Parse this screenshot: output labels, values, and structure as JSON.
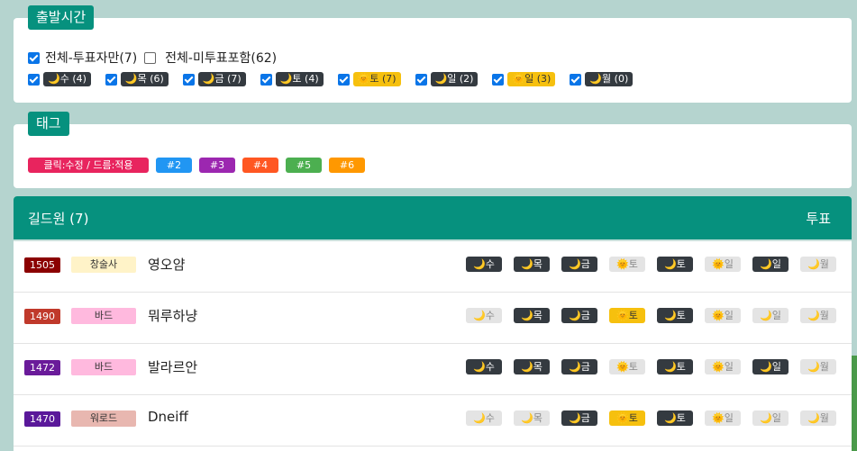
{
  "departure": {
    "title": "출발시간",
    "all_voted": "전체-투표자만(7)",
    "all_including": "전체-미투표포함(62)",
    "slots": [
      {
        "label": "🌙수 (4)",
        "sun": false
      },
      {
        "label": "🌙목 (6)",
        "sun": false
      },
      {
        "label": "🌙금 (7)",
        "sun": false
      },
      {
        "label": "🌙토 (4)",
        "sun": false
      },
      {
        "label": "🌞토 (7)",
        "sun": true
      },
      {
        "label": "🌙일 (2)",
        "sun": false
      },
      {
        "label": "🌞일 (3)",
        "sun": true
      },
      {
        "label": "🌙월 (0)",
        "sun": false
      }
    ]
  },
  "tags": {
    "title": "태그",
    "items": [
      {
        "label": "클릭:수정 / 드름:적용",
        "color": "#e8245e",
        "width": 134
      },
      {
        "label": "#2",
        "color": "#2196f3",
        "width": 40
      },
      {
        "label": "#3",
        "color": "#9c27b0",
        "width": 40
      },
      {
        "label": "#4",
        "color": "#ff5722",
        "width": 40
      },
      {
        "label": "#5",
        "color": "#4caf50",
        "width": 40
      },
      {
        "label": "#6",
        "color": "#ff9800",
        "width": 40
      }
    ]
  },
  "members": {
    "title": "길드원 (7)",
    "vote_header": "투표",
    "rows": [
      {
        "score": "1505",
        "score_color": "#8b0000",
        "cls": "창술사",
        "cls_color": "#fff3c8",
        "name": "영오얌",
        "days": [
          [
            "🌙수",
            "on"
          ],
          [
            "🌙목",
            "on"
          ],
          [
            "🌙금",
            "on"
          ],
          [
            "🌞토",
            "off"
          ],
          [
            "🌙토",
            "on"
          ],
          [
            "🌞일",
            "off"
          ],
          [
            "🌙일",
            "on"
          ],
          [
            "🌙월",
            "off"
          ]
        ]
      },
      {
        "score": "1490",
        "score_color": "#c0392b",
        "cls": "바드",
        "cls_color": "#ffb9de",
        "name": "뭐루하냥",
        "days": [
          [
            "🌙수",
            "off"
          ],
          [
            "🌙목",
            "on"
          ],
          [
            "🌙금",
            "on"
          ],
          [
            "🌞토",
            "sunon"
          ],
          [
            "🌙토",
            "on"
          ],
          [
            "🌞일",
            "off"
          ],
          [
            "🌙일",
            "off"
          ],
          [
            "🌙월",
            "off"
          ]
        ]
      },
      {
        "score": "1472",
        "score_color": "#6a1b9a",
        "cls": "바드",
        "cls_color": "#ffb9de",
        "name": "발라르안",
        "days": [
          [
            "🌙수",
            "on"
          ],
          [
            "🌙목",
            "on"
          ],
          [
            "🌙금",
            "on"
          ],
          [
            "🌞토",
            "off"
          ],
          [
            "🌙토",
            "on"
          ],
          [
            "🌞일",
            "off"
          ],
          [
            "🌙일",
            "on"
          ],
          [
            "🌙월",
            "off"
          ]
        ]
      },
      {
        "score": "1470",
        "score_color": "#5a189a",
        "cls": "워로드",
        "cls_color": "#e8b7b0",
        "name": "Dneiff",
        "days": [
          [
            "🌙수",
            "off"
          ],
          [
            "🌙목",
            "off"
          ],
          [
            "🌙금",
            "on"
          ],
          [
            "🌞토",
            "sunon"
          ],
          [
            "🌙토",
            "on"
          ],
          [
            "🌞일",
            "off"
          ],
          [
            "🌙일",
            "off"
          ],
          [
            "🌙월",
            "off"
          ]
        ]
      }
    ]
  }
}
